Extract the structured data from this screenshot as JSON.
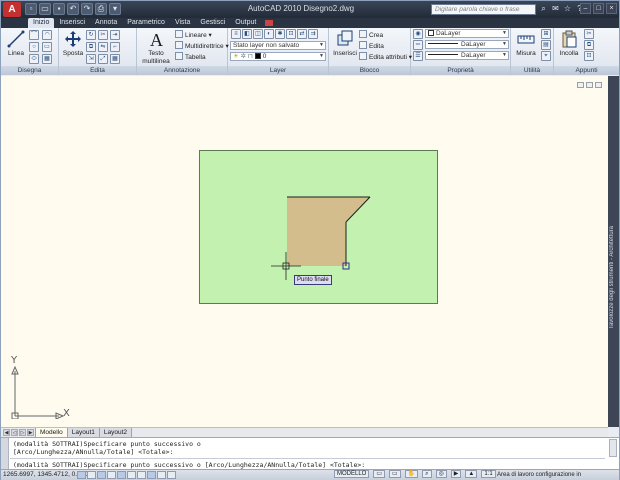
{
  "window": {
    "title": "AutoCAD 2010    Disegno2.dwg",
    "app_button": "A",
    "search_placeholder": "Digitare parola chiave o frase"
  },
  "ribbon_tabs": [
    "Inizio",
    "Inserisci",
    "Annota",
    "Parametrico",
    "Vista",
    "Gestisci",
    "Output"
  ],
  "panels": {
    "disegna": {
      "title": "Disegna",
      "tool_linea": "Linea"
    },
    "edita": {
      "title": "Edita",
      "tool_sposta": "Sposta"
    },
    "annotazione": {
      "title": "Annotazione",
      "tool_testo": "Testo",
      "tool_testo_sub": "multilinea",
      "tool_lineare": "Lineare",
      "tool_multidirettrice": "Multidirettrice",
      "tool_tabella": "Tabella"
    },
    "layer": {
      "title": "Layer",
      "state_value": "Stato layer non salvato",
      "current_layer": "0"
    },
    "blocco": {
      "title": "Blocco",
      "tool_inserisci": "Inserisci",
      "tool_crea": "Crea",
      "tool_edita": "Edita",
      "tool_edita_attributi": "Edita attributi"
    },
    "proprieta": {
      "title": "Proprietà",
      "color": "DaLayer",
      "linetype": "DaLayer",
      "lineweight": "DaLayer"
    },
    "utilita": {
      "title": "Utilità",
      "tool_misura": "Misura"
    },
    "appunti": {
      "title": "Appunti",
      "tool_incolla": "Incolla"
    }
  },
  "drawing": {
    "tooltip": "Punto finale",
    "ucs_x": "X",
    "ucs_y": "Y",
    "side_palette_label": "Tavolozze degli strumenti - Architettura",
    "colors": {
      "background": "#fffbee",
      "region": "#c3f2b0",
      "shape": "#d4bd8c"
    }
  },
  "layout_tabs": [
    "Modello",
    "Layout1",
    "Layout2"
  ],
  "command_line": {
    "history": [
      "(modalità SOTTRAI)Specificare punto successivo o",
      "[Arco/Lunghezza/ANnulla/Totale] <Totale>:"
    ],
    "current": "(modalità SOTTRAI)Specificare punto successivo o [Arco/Lunghezza/ANnulla/Totale] <Totale>:"
  },
  "status_bar": {
    "coordinates": "1265.6997, 1345.4712, 0.0000",
    "model": "MODELLO",
    "scale": "1:1",
    "workspace": "Area di lavoro configurazione in"
  }
}
